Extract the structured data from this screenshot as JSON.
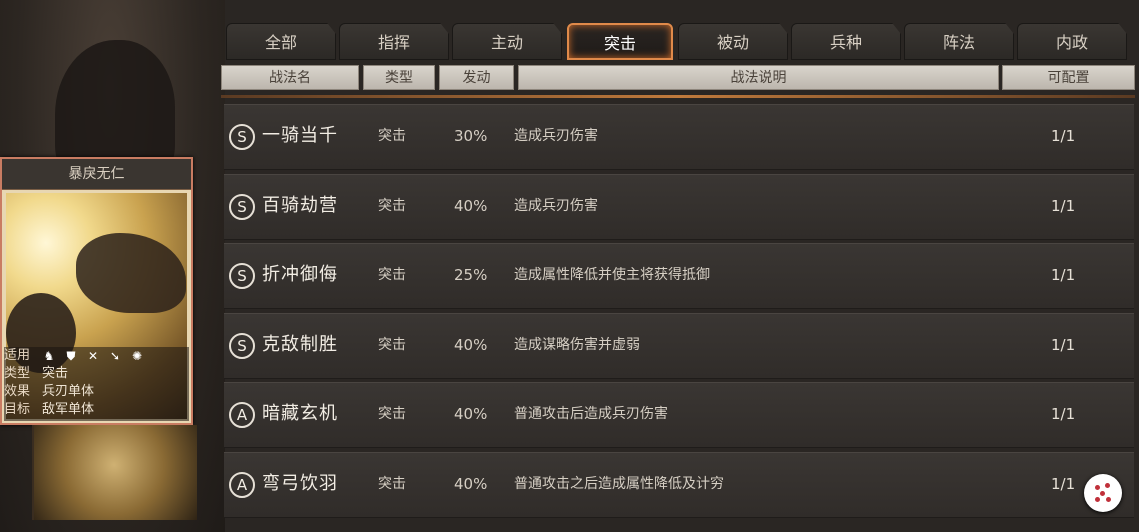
{
  "card": {
    "title": "暴戾无仁",
    "info": [
      {
        "key": "适用",
        "value": ""
      },
      {
        "key": "类型",
        "value": "突击"
      },
      {
        "key": "效果",
        "value": "兵刃单体"
      },
      {
        "key": "目标",
        "value": "敌军单体"
      }
    ],
    "troop_icons": [
      "cavalry-icon",
      "shield-icon",
      "bow-icon",
      "spear-icon",
      "chariot-icon"
    ]
  },
  "tabs": [
    {
      "label": "全部",
      "active": false
    },
    {
      "label": "指挥",
      "active": false
    },
    {
      "label": "主动",
      "active": false
    },
    {
      "label": "突击",
      "active": true
    },
    {
      "label": "被动",
      "active": false
    },
    {
      "label": "兵种",
      "active": false
    },
    {
      "label": "阵法",
      "active": false
    },
    {
      "label": "内政",
      "active": false
    }
  ],
  "columns": {
    "name": "战法名",
    "type": "类型",
    "rate": "发动",
    "desc": "战法说明",
    "config": "可配置"
  },
  "skills": [
    {
      "grade": "S",
      "name": "一骑当千",
      "type": "突击",
      "rate": "30%",
      "desc": "造成兵刃伤害",
      "count": "1/1"
    },
    {
      "grade": "S",
      "name": "百骑劫营",
      "type": "突击",
      "rate": "40%",
      "desc": "造成兵刃伤害",
      "count": "1/1"
    },
    {
      "grade": "S",
      "name": "折冲御侮",
      "type": "突击",
      "rate": "25%",
      "desc": "造成属性降低并使主将获得抵御",
      "count": "1/1"
    },
    {
      "grade": "S",
      "name": "克敌制胜",
      "type": "突击",
      "rate": "40%",
      "desc": "造成谋略伤害并虚弱",
      "count": "1/1"
    },
    {
      "grade": "A",
      "name": "暗藏玄机",
      "type": "突击",
      "rate": "40%",
      "desc": "普通攻击后造成兵刃伤害",
      "count": "1/1"
    },
    {
      "grade": "A",
      "name": "弯弓饮羽",
      "type": "突击",
      "rate": "40%",
      "desc": "普通攻击之后造成属性降低及计穷",
      "count": "1/1"
    }
  ],
  "colors": {
    "active_tab_border": "#e08a4a",
    "card_border": "#c97c62",
    "row_bg": "#353130"
  }
}
